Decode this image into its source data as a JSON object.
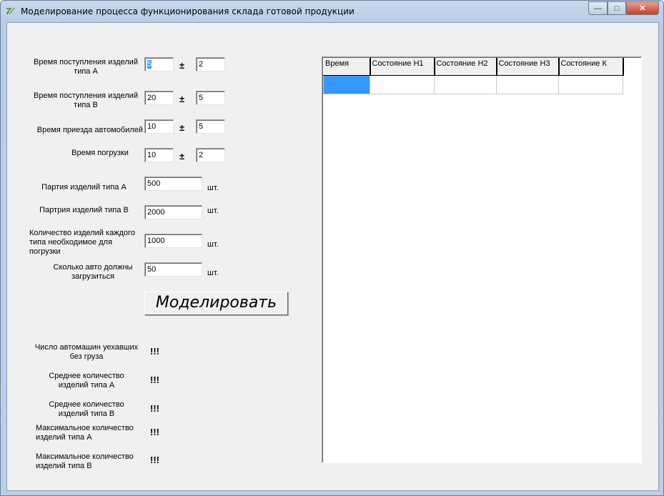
{
  "window": {
    "title": "Моделирование процесса функционирования склада готовой продукции",
    "controls": {
      "minimize": "—",
      "maximize": "□",
      "close": "✕"
    }
  },
  "params": [
    {
      "label": "Время поступления изделий типа А",
      "value": "5",
      "deviation": "2"
    },
    {
      "label": "Время поступления изделий типа В",
      "value": "20",
      "deviation": "5"
    },
    {
      "label": "Время приезда автомобилей",
      "value": "10",
      "deviation": "5"
    },
    {
      "label": "Время погрузки",
      "value": "10",
      "deviation": "2"
    }
  ],
  "plusminus": "±",
  "quantities": [
    {
      "label": "Партия изделий типа А",
      "value": "500",
      "unit": "шт."
    },
    {
      "label": "Партрия изделий типа В",
      "value": "2000",
      "unit": "шт."
    },
    {
      "label": "Количество изделий каждого типа необходимое для погрузки",
      "value": "1000",
      "unit": "шт."
    },
    {
      "label": "Сколько авто должны загрузиться",
      "value": "50",
      "unit": "шт."
    }
  ],
  "simulate_button": "Моделировать",
  "results": [
    {
      "label": "Число автомашин уехавших без груза",
      "value": "!!!"
    },
    {
      "label": "Среднее количество изделий типа А",
      "value": "!!!"
    },
    {
      "label": "Среднее количество изделий типа В",
      "value": "!!!"
    },
    {
      "label": "Максимальное количество изделий типа А",
      "value": "!!!"
    },
    {
      "label": "Максимальное количество изделий типа В",
      "value": "!!!"
    }
  ],
  "grid": {
    "columns": [
      "Время",
      "Состояние Н1",
      "Состояние Н2",
      "Состояние Н3",
      "Состояние К"
    ],
    "selection_color": "#3399ff"
  }
}
